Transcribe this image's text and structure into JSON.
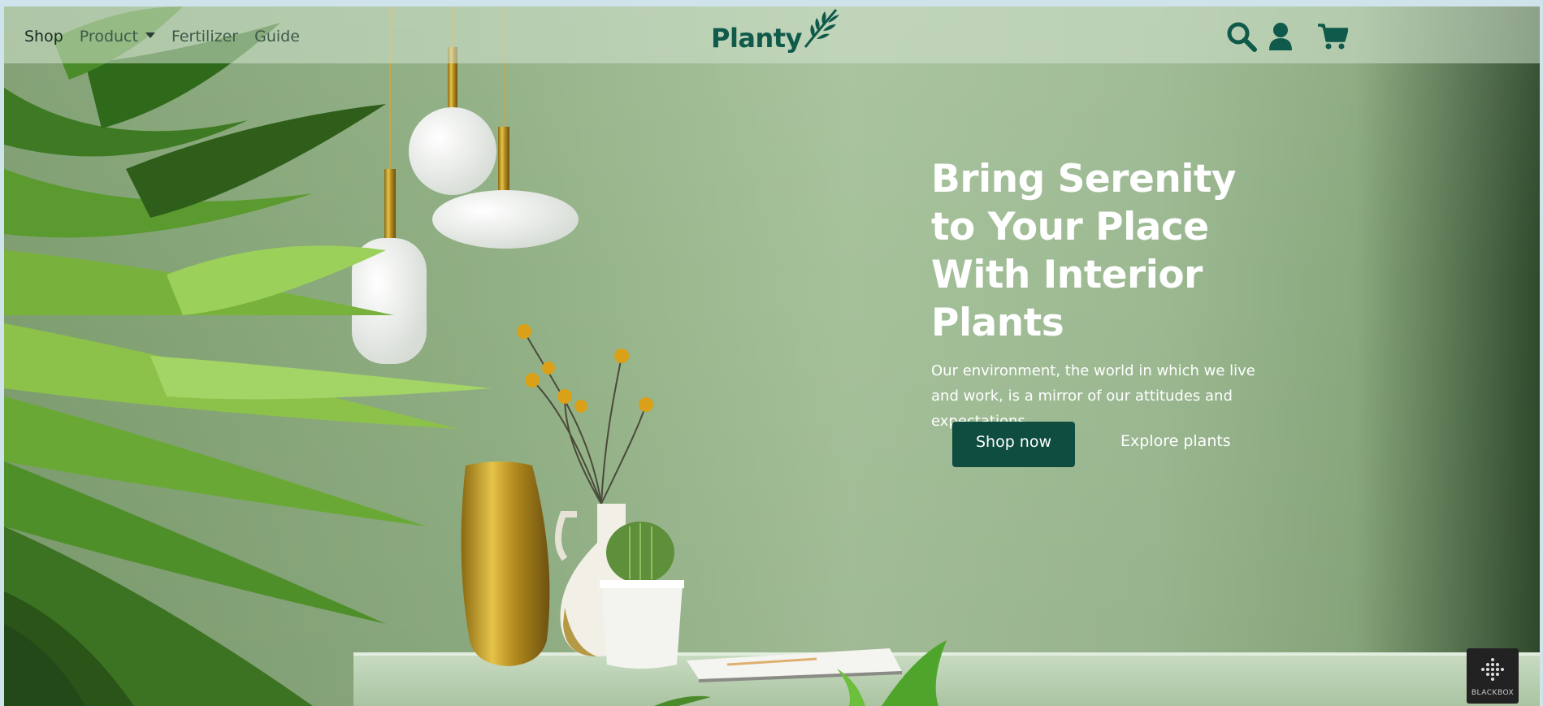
{
  "nav": {
    "links": [
      {
        "label": "Shop",
        "active": true
      },
      {
        "label": "Product",
        "dropdown": true
      },
      {
        "label": "Fertilizer"
      },
      {
        "label": "Guide"
      }
    ]
  },
  "brand": {
    "name": "Planty",
    "color": "#0f5a4a"
  },
  "icons": [
    "search-icon",
    "user-icon",
    "cart-icon"
  ],
  "hero": {
    "title": "Bring Serenity to Your Place With Interior Plants",
    "subtitle": "Our environment, the world in which we live and work, is a mirror of our attitudes and expectations.",
    "primary_button": "Shop now",
    "secondary_button": "Explore plants"
  },
  "badge": {
    "label": "BLACKBOX"
  },
  "colors": {
    "accent": "#0e4d3f",
    "wall": "#9cb992"
  }
}
